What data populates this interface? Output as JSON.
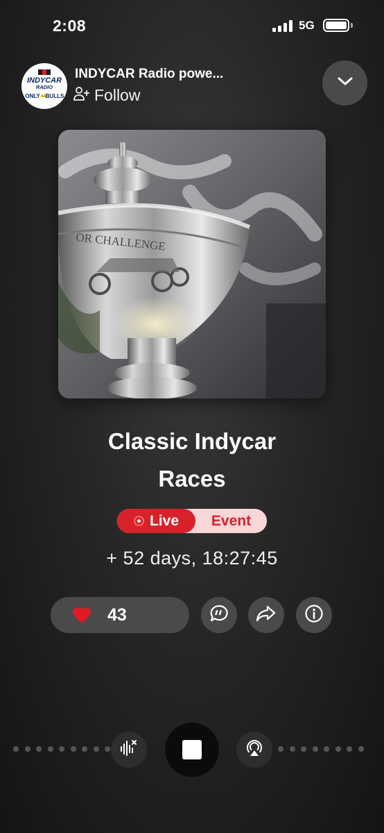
{
  "status_bar": {
    "time": "2:08",
    "network": "5G"
  },
  "header": {
    "station_name": "INDYCAR Radio powe...",
    "follow_label": "Follow",
    "logo_text": {
      "line1": "INDYCAR",
      "line2": "RADIO",
      "line3": "ONLY",
      "line4": "BULLS"
    }
  },
  "artwork": {
    "engraving": "OR CHALLENGE"
  },
  "episode": {
    "title_line1": "Classic Indycar",
    "title_line2": "Races",
    "live_label": "Live",
    "event_label": "Event",
    "elapsed": "+ 52 days, 18:27:45"
  },
  "actions": {
    "like_count": "43",
    "icons": [
      "heart-icon",
      "comment-icon",
      "share-icon",
      "info-icon"
    ]
  },
  "player": {
    "icons": [
      "mute-sound-icon",
      "stop-icon",
      "airplay-icon"
    ]
  },
  "colors": {
    "accent": "#d8222a",
    "live_pill_bg": "#f8d7d8",
    "button_bg": "#4a4a4a"
  }
}
